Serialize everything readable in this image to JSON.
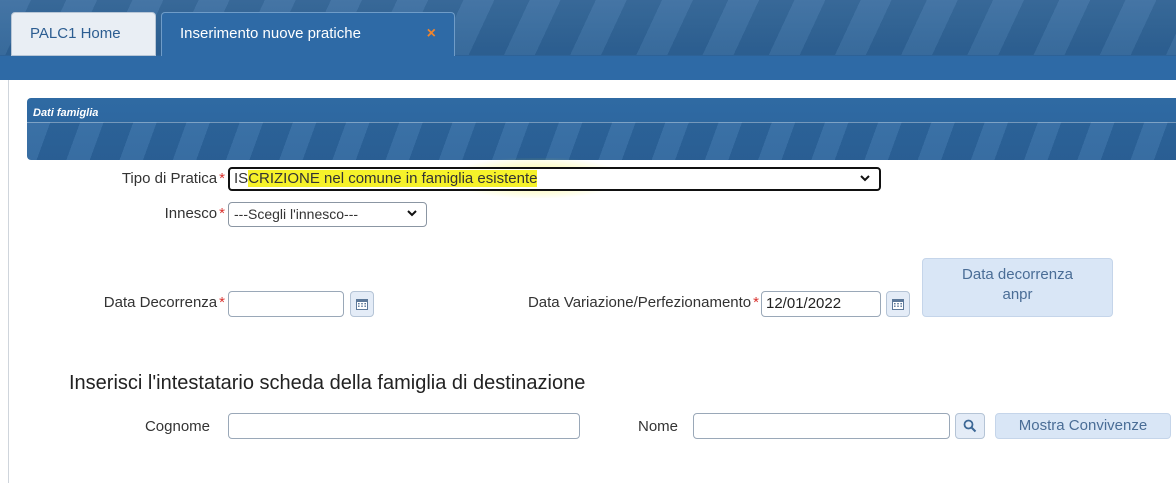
{
  "tabs": {
    "home_label": "PALC1 Home",
    "active_label": "Inserimento nuove pratiche",
    "close_glyph": "×"
  },
  "section": {
    "title": "Dati famiglia"
  },
  "form": {
    "tipo_pratica": {
      "label": "Tipo di Pratica",
      "required_mark": "*",
      "value_prefix": "IS",
      "value_highlighted": "CRIZIONE nel comune in famiglia esistente",
      "highlight_color": "#f6f22a"
    },
    "innesco": {
      "label": "Innesco",
      "required_mark": "*",
      "value": "---Scegli l'innesco---"
    },
    "data_decorrenza": {
      "label": "Data Decorrenza",
      "required_mark": "*",
      "value": ""
    },
    "data_variazione": {
      "label": "Data Variazione/Perfezionamento",
      "required_mark": "*",
      "value": "12/01/2022"
    },
    "data_decorrenza_anpr_button": {
      "line1": "Data decorrenza",
      "line2": "anpr"
    }
  },
  "intestatario": {
    "heading": "Inserisci l'intestatario scheda della famiglia di destinazione",
    "cognome_label": "Cognome",
    "cognome_value": "",
    "nome_label": "Nome",
    "nome_value": "",
    "mostra_convivenze_label": "Mostra Convivenze"
  },
  "icons": {
    "calendar": "calendar-icon",
    "search": "search-icon",
    "dropdown": "chevron-down-icon",
    "close": "close-icon"
  },
  "colors": {
    "header_blue": "#2e6aa6",
    "required_red": "#d9302c",
    "close_orange": "#f0852e",
    "button_light": "#d9e6f6"
  }
}
